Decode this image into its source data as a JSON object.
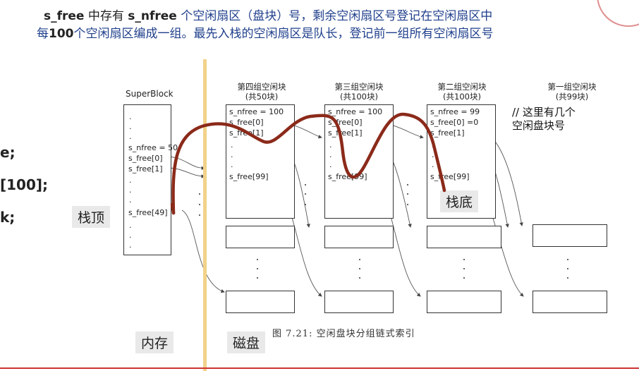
{
  "header": {
    "line1": {
      "t1": "s_free",
      "t2": " 中存有 ",
      "t3": "s_nfree",
      "t4": " 个空闲扇区（盘块）号，剩余空闲扇区号登记在空闲扇区中"
    },
    "line2": {
      "t1": "每",
      "t2": "100",
      "t3": "个空闲扇区编成一组。最先入栈的空闲扇区是队长，登记前一组所有空闲扇区号"
    }
  },
  "code_fragments": [
    "e;",
    "[100];",
    "k;"
  ],
  "tags": {
    "stack_top": "栈顶",
    "stack_bottom": "栈底",
    "memory": "内存",
    "disk": "磁盘"
  },
  "superblock": {
    "title": "SuperBlock",
    "s_nfree": "s_nfree = 50",
    "s_free0": "s_free[0]",
    "s_free1": "s_free[1]",
    "s_free49": "s_free[49]",
    "dot": "."
  },
  "groups": [
    {
      "title": "第四组空闲块",
      "sub": "(共50块)",
      "nfree": "s_nfree = 100",
      "f0": "s_free[0]",
      "f1": "s_free[1]",
      "flast": "s_free[99]"
    },
    {
      "title": "第三组空闲块",
      "sub": "(共100块)",
      "nfree": "s_nfree = 100",
      "f0": "s_free[0]",
      "f1": "s_free[1]",
      "flast": "s_free[99]"
    },
    {
      "title": "第二组空闲块",
      "sub": "(共100块)",
      "nfree": "s_nfree = 99",
      "f0": "s_free[0] =0",
      "f1": "s_free[1]",
      "flast": "s_free[99]"
    },
    {
      "title": "第一组空闲块",
      "sub": "(共99块)"
    }
  ],
  "note": {
    "line1": "// 这里有几个",
    "line2": "空闲盘块号"
  },
  "caption": "图 7.21:  空闲盘块分组链式索引",
  "colors": {
    "heading_blue": "#1f3f8c",
    "curve": "#8b2a1a",
    "divider": "#f2d28a",
    "bottom_rule": "#c33"
  }
}
